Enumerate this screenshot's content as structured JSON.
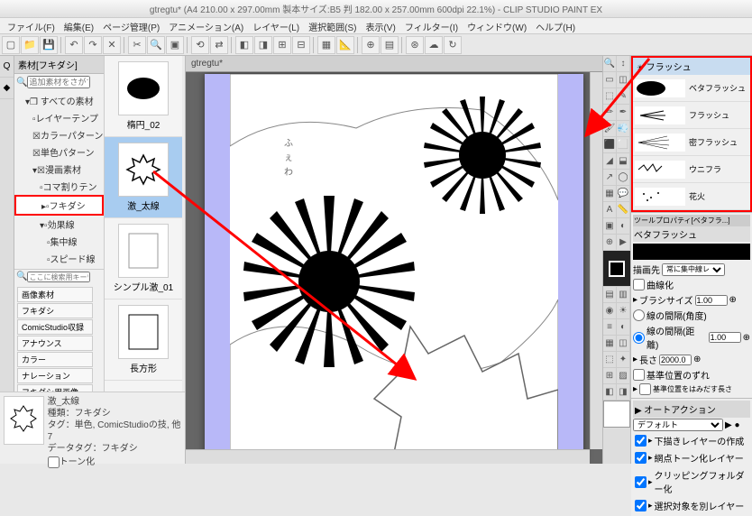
{
  "title": "gtregtu* (A4 210.00 x 297.00mm 製本サイズ:B5 判 182.00 x 257.00mm 600dpi 22.1%)   - CLIP STUDIO PAINT EX",
  "menu": {
    "file": "ファイル(F)",
    "edit": "編集(E)",
    "page": "ページ管理(P)",
    "anim": "アニメーション(A)",
    "layer": "レイヤー(L)",
    "select": "選択範囲(S)",
    "view": "表示(V)",
    "filter": "フィルター(I)",
    "window": "ウィンドウ(W)",
    "help": "ヘルプ(H)"
  },
  "canvas_tab": "gtregtu*",
  "nav": {
    "header": "素材[フキダシ]",
    "search_placeholder": "追加素材をさがす",
    "items": [
      "すべての素材",
      "レイヤーテンプ",
      "カラーパターン",
      "単色パターン",
      "漫画素材",
      "コマ割りテン",
      "フキダシ",
      "効果線",
      "集中線",
      "スピード線"
    ],
    "kw_placeholder": "ここに検索用キーワードを",
    "tags": [
      "画像素材",
      "フキダシ",
      "ComicStudio収録",
      "アナウンス",
      "カラー",
      "ナレーション",
      "フキダシ用画像"
    ]
  },
  "previews": [
    {
      "label": "楕円_02"
    },
    {
      "label": "激_太線"
    },
    {
      "label": "シンプル激_01"
    },
    {
      "label": "長方形"
    }
  ],
  "detail": {
    "name": "激_太線",
    "type": "種類：フキダシ",
    "tags": "タグ：単色, ComicStudioの技, 他7",
    "data": "データタグ：フキダシ",
    "tone": "トーン化"
  },
  "brushes": {
    "tab": "フラッシュ",
    "items": [
      "ベタフラッシュ",
      "フラッシュ",
      "密フラッシュ",
      "ウニフラ",
      "花火"
    ],
    "prop_header": "ツールプロパティ[ベタフラ...]",
    "prop_name": "ベタフラッシュ",
    "dest_label": "描画先",
    "dest_value": "常に集中線レイヤーを",
    "curve": "曲線化",
    "brush_size": "ブラシサイズ",
    "brush_val": "1.00",
    "gap_angle": "線の間隔(角度)",
    "gap_dist": "線の間隔(距離)",
    "gap_val": "1.00",
    "length": "長さ",
    "length_val": "2000.0",
    "base_shift": "基準位置のずれ",
    "base_bulge": "基準位置をはみだす長さ"
  },
  "actions": {
    "header": "オートアクション",
    "set": "デフォルト",
    "items": [
      "下描きレイヤーの作成",
      "網点トーン化レイヤー",
      "クリッピングフォルダー化",
      "選択対象を別レイヤー"
    ]
  }
}
